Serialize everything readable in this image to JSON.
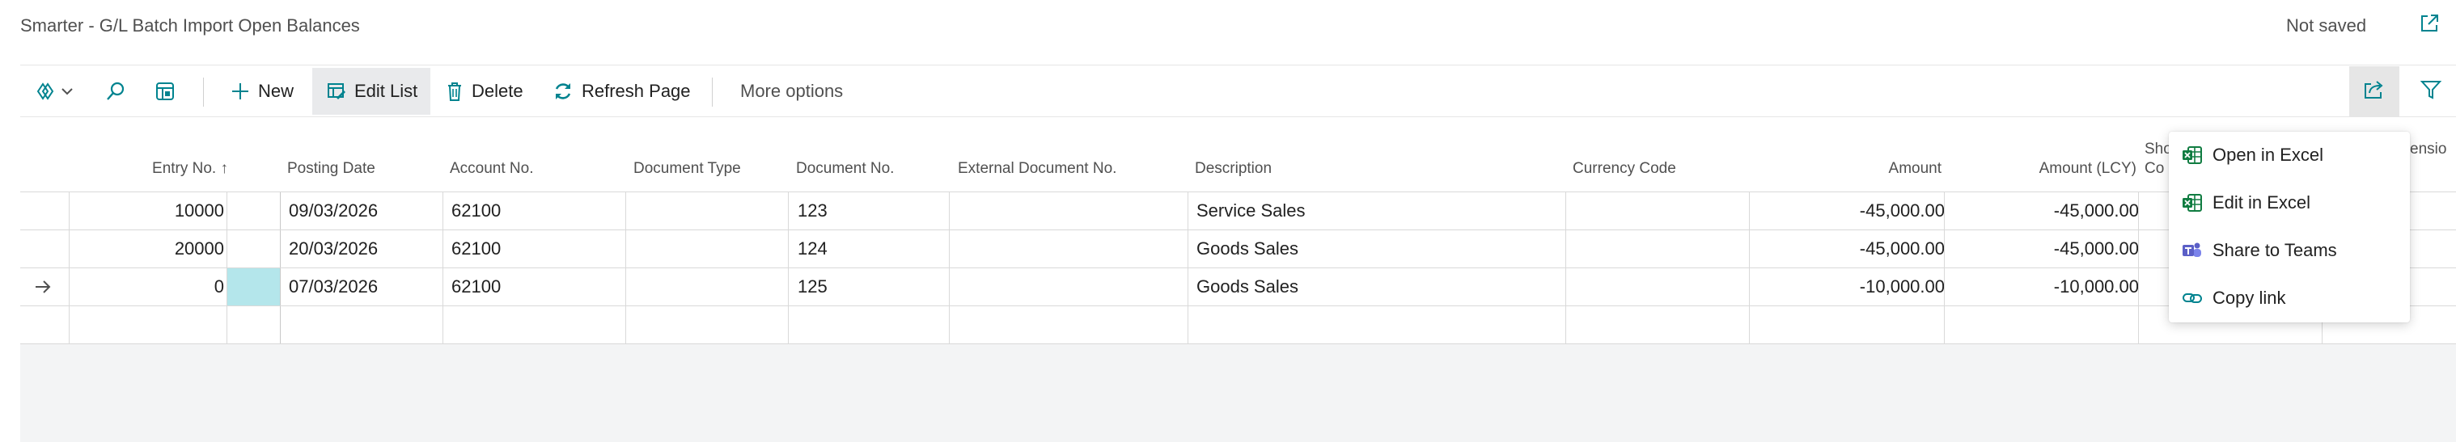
{
  "page": {
    "title": "Smarter - G/L Batch Import Open Balances",
    "save_status": "Not saved",
    "popout_icon": "popout-icon"
  },
  "toolbar": {
    "new_label": "New",
    "edit_list_label": "Edit List",
    "delete_label": "Delete",
    "refresh_label": "Refresh Page",
    "more_options_label": "More options",
    "icons": [
      "view-switch-icon",
      "search-icon",
      "layout-icon",
      "plus-icon",
      "edit-list-icon",
      "trash-icon",
      "refresh-icon",
      "share-icon",
      "filter-icon"
    ]
  },
  "columns": {
    "entry_no": "Entry No. ↑",
    "posting_date": "Posting Date",
    "account_no": "Account No.",
    "document_type": "Document Type",
    "document_no": "Document No.",
    "external_document_no": "External Document No.",
    "description": "Description",
    "currency_code": "Currency Code",
    "amount": "Amount",
    "amount_lcy": "Amount (LCY)",
    "shortcut_partial": "Sho",
    "shortcut_partial_line2": "Co",
    "dimension_partial": "imensio"
  },
  "rows": [
    {
      "entry_no": "10000",
      "posting_date": "09/03/2026",
      "account_no": "62100",
      "document_type": "",
      "document_no": "123",
      "external_document_no": "",
      "description": "Service Sales",
      "currency_code": "",
      "amount": "-45,000.00",
      "amount_lcy": "-45,000.00",
      "selected": false
    },
    {
      "entry_no": "20000",
      "posting_date": "20/03/2026",
      "account_no": "62100",
      "document_type": "",
      "document_no": "124",
      "external_document_no": "",
      "description": "Goods Sales",
      "currency_code": "",
      "amount": "-45,000.00",
      "amount_lcy": "-45,000.00",
      "selected": false
    },
    {
      "entry_no": "0",
      "posting_date": "07/03/2026",
      "account_no": "62100",
      "document_type": "",
      "document_no": "125",
      "external_document_no": "",
      "description": "Goods Sales",
      "currency_code": "",
      "amount": "-10,000.00",
      "amount_lcy": "-10,000.00",
      "selected": true
    },
    {
      "entry_no": "",
      "posting_date": "",
      "account_no": "",
      "document_type": "",
      "document_no": "",
      "external_document_no": "",
      "description": "",
      "currency_code": "",
      "amount": "",
      "amount_lcy": "",
      "selected": false
    }
  ],
  "share_menu": {
    "items": [
      {
        "label": "Open in Excel",
        "icon": "excel-icon"
      },
      {
        "label": "Edit in Excel",
        "icon": "excel-icon"
      },
      {
        "label": "Share to Teams",
        "icon": "teams-icon"
      },
      {
        "label": "Copy link",
        "icon": "link-icon"
      }
    ]
  },
  "colors": {
    "selected_cell": "#b4e6eb",
    "accent": "#00838f",
    "excel_green": "#107c41",
    "teams_purple": "#5b5fc7"
  }
}
